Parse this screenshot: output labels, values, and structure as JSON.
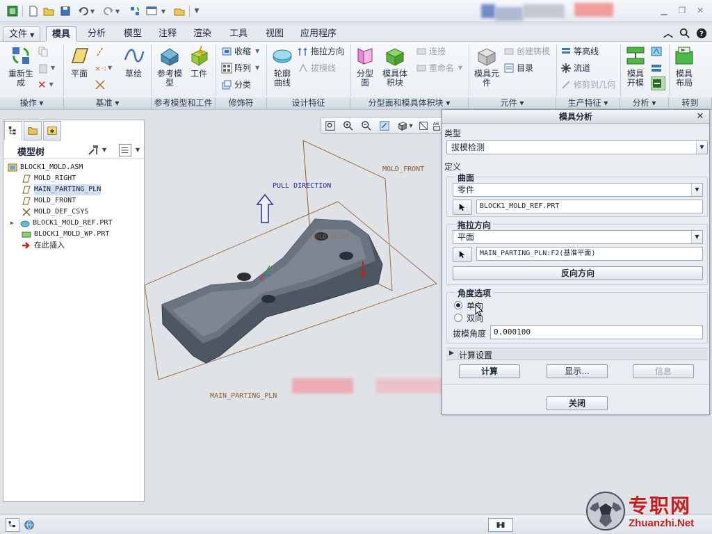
{
  "menu_tabs": {
    "file": "文件",
    "mold": "模具",
    "analysis": "分析",
    "model": "模型",
    "annotate": "注释",
    "render": "渲染",
    "tools": "工具",
    "view": "视图",
    "apps": "应用程序"
  },
  "ribbon": {
    "regenerate": "重新生\n成",
    "plane": "平面",
    "sketch": "草绘",
    "ref_model": "参考模\n型",
    "workpiece": "工件",
    "shrink": "收缩",
    "pattern": "阵列",
    "classify": "分类",
    "silhouette": "轮廓\n曲线",
    "pull_direction": "拖拉方向",
    "draft_line": "拔模线",
    "parting_surface": "分型\n面",
    "mold_volume": "模具体\n积块",
    "connect": "连接",
    "rename": "重命名",
    "mold_component": "模具元\n件",
    "create_casting": "创建铸模",
    "catalog": "目录",
    "contour": "等高线",
    "flow": "流道",
    "trim_geometry": "修剪到几何",
    "mold_open": "模具\n开模",
    "mold_layout": "模具\n布局",
    "groups": {
      "operations": "操作",
      "datum": "基准",
      "ref_model_workpiece": "参考模型和工件",
      "modifiers": "修饰符",
      "design_features": "设计特征",
      "parting_volume": "分型面和模具体积块",
      "components": "元件",
      "production_features": "生产特征",
      "analysis": "分析",
      "goto": "转到"
    }
  },
  "model_tree": {
    "title": "模型树",
    "items": [
      "BLOCK1_MOLD.ASM",
      "MOLD_RIGHT",
      "MAIN_PARTING_PLN",
      "MOLD_FRONT",
      "MOLD_DEF_CSYS",
      "BLOCK1_MOLD_REF.PRT",
      "BLOCK1_MOLD_WP.PRT",
      "在此插入"
    ]
  },
  "viewport_labels": {
    "pull_direction": "PULL DIRECTION",
    "mold_front": "MOLD_FRONT",
    "mold_right": "MOLD_RIGHT",
    "main_parting": "MAIN_PARTING_PLN"
  },
  "dialog": {
    "title": "模具分析",
    "type_label": "类型",
    "type_value": "拔模检测",
    "definition_label": "定义",
    "surface_legend": "曲面",
    "surface_type": "零件",
    "surface_ref": "BLOCK1_MOLD_REF.PRT",
    "pull_legend": "拖拉方向",
    "pull_type": "平面",
    "pull_ref": "MAIN_PARTING_PLN:F2(基准平面)",
    "flip_button": "反向方向",
    "angle_legend": "角度选项",
    "one_side": "单向",
    "both_sides": "双向",
    "draft_angle_label": "拔模角度",
    "draft_angle_value": "0.000100",
    "compute_settings": "计算设置",
    "compute_button": "计算",
    "display_button": "显示...",
    "info_button": "信息",
    "close_button": "关闭"
  },
  "watermark": {
    "cn": "专职网",
    "en": "Zhuanzhi.Net"
  }
}
